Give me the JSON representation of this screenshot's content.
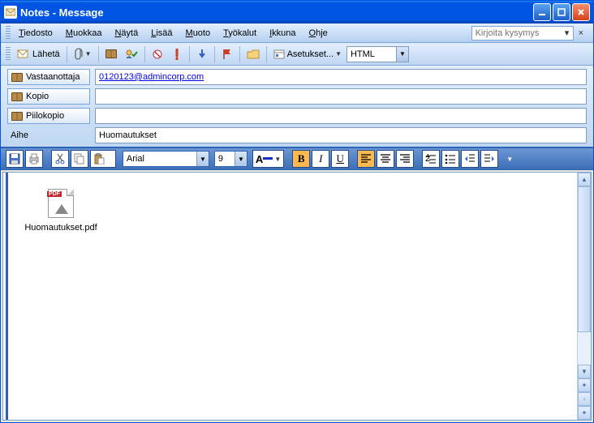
{
  "window": {
    "title": "Notes - Message"
  },
  "menu": {
    "tiedosto": "Tiedosto",
    "muokkaa": "Muokkaa",
    "nayta": "Näytä",
    "lisaa": "Lisää",
    "muoto": "Muoto",
    "tyokalut": "Työkalut",
    "ikkuna": "Ikkuna",
    "ohje": "Ohje",
    "ask_placeholder": "Kirjoita kysymys"
  },
  "toolbar1": {
    "send": "Lähetä",
    "settings": "Asetukset...",
    "format_combo": "HTML"
  },
  "headers": {
    "to_label": "Vastaanottaja",
    "to_value": "0120123@admincorp.com",
    "cc_label": "Kopio",
    "cc_value": "",
    "bcc_label": "Piilokopio",
    "bcc_value": "",
    "subject_label": "Aihe",
    "subject_value": "Huomautukset"
  },
  "toolbar2": {
    "font_name": "Arial",
    "font_size": "9"
  },
  "body": {
    "attachment_name": "Huomautukset.pdf",
    "pdf_badge": "PDF"
  }
}
